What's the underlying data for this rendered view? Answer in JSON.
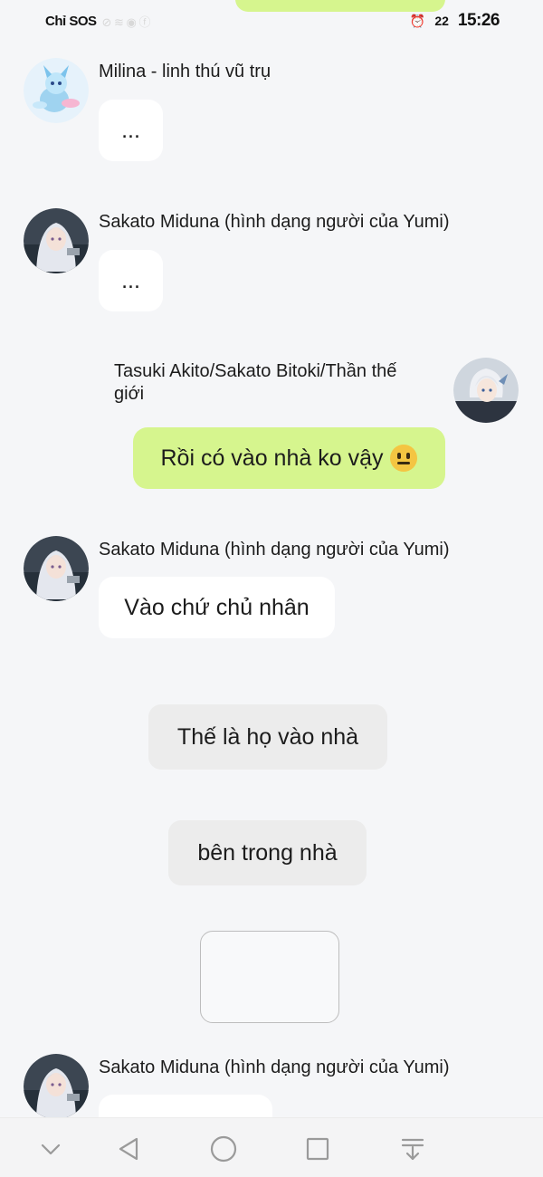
{
  "status_bar": {
    "carrier": "Chỉ SOS",
    "faint_icons": "⊘ ≋ ◉ ⓕ",
    "alarm": "⏰",
    "battery": "22",
    "time": "15:26"
  },
  "messages": [
    {
      "sender": "Milina - linh thú vũ trụ",
      "text": "...",
      "avatar_icon": "blue-creature-avatar"
    },
    {
      "sender": "Sakato Miduna (hình dạng người của Yumi)",
      "text": "...",
      "avatar_icon": "silver-hair-girl-avatar"
    },
    {
      "sender": "Tasuki Akito/Sakato Bitoki/Thần thế giới",
      "sender_line1": "Tasuki Akito/Sakato Bitoki/Thần thế",
      "sender_line2": "giới",
      "text": "Rồi có vào nhà ko vậy",
      "emoji": "neutral-face",
      "avatar_icon": "silver-hair-boy-avatar"
    },
    {
      "sender": "Sakato Miduna (hình dạng người của Yumi)",
      "text": "Vào chứ chủ nhân",
      "avatar_icon": "silver-hair-girl-avatar"
    },
    {
      "sender": "Sakato Miduna (hình dạng người của Yumi)",
      "text": "",
      "avatar_icon": "silver-hair-girl-avatar"
    }
  ],
  "narration": [
    "Thế là họ vào nhà",
    "bên trong nhà"
  ],
  "nav_bar": {
    "buttons": [
      "collapse",
      "back",
      "home",
      "recents",
      "notifications"
    ]
  },
  "colors": {
    "background": "#f5f6f8",
    "my_bubble": "#d6f58e",
    "other_bubble": "#ffffff",
    "narration_bubble": "#ececec"
  }
}
